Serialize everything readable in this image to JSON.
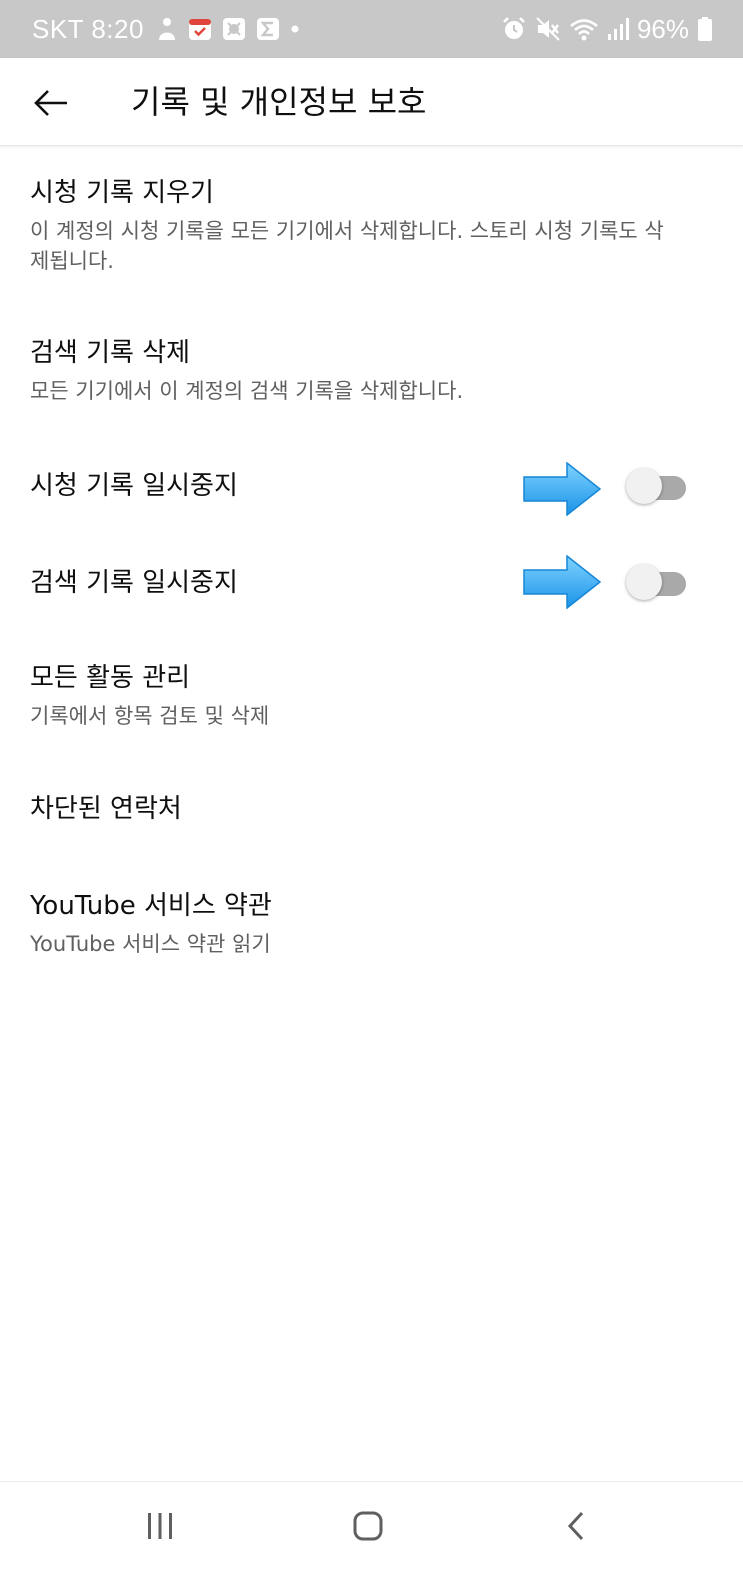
{
  "status_bar": {
    "carrier": "SKT",
    "time": "8:20",
    "battery": "96%",
    "left_icons": [
      "person-icon",
      "calendar-icon",
      "gallery-icon",
      "sigma-icon",
      "dot-icon"
    ],
    "right_icons": [
      "alarm-icon",
      "mute-icon",
      "wifi-icon",
      "signal-icon",
      "battery-icon"
    ]
  },
  "app_bar": {
    "title": "기록 및 개인정보 보호"
  },
  "items": [
    {
      "title": "시청 기록 지우기",
      "subtitle": "이 계정의 시청 기록을 모든 기기에서 삭제합니다. 스토리 시청 기록도 삭제됩니다."
    },
    {
      "title": "검색 기록 삭제",
      "subtitle": "모든 기기에서 이 계정의 검색 기록을 삭제합니다."
    },
    {
      "title": "시청 기록 일시중지",
      "toggle": "off"
    },
    {
      "title": "검색 기록 일시중지",
      "toggle": "off"
    },
    {
      "title": "모든 활동 관리",
      "subtitle": "기록에서 항목 검토 및 삭제"
    },
    {
      "title": "차단된 연락처"
    },
    {
      "title": "YouTube 서비스 약관",
      "subtitle": "YouTube 서비스 약관 읽기"
    }
  ],
  "colors": {
    "status_bar_bg": "#c8c8c8",
    "annotation_arrow": "#29a8f5",
    "toggle_track_off": "#a9a9a9",
    "toggle_thumb": "#f1f1f1"
  },
  "nav_bar": {
    "buttons": [
      "recent-apps-icon",
      "home-icon",
      "back-icon"
    ]
  }
}
